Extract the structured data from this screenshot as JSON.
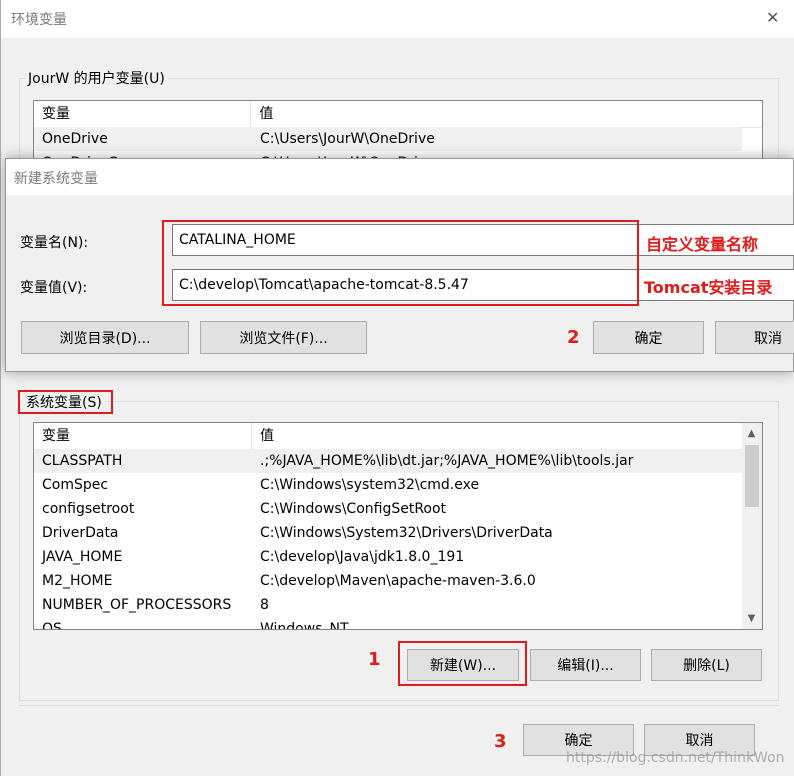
{
  "main_window": {
    "title": "环境变量",
    "close_glyph": "✕",
    "user_group_label": "JourW 的用户变量(U)",
    "user_table": {
      "headers": [
        "变量",
        "值"
      ],
      "rows": [
        [
          "OneDrive",
          "C:\\Users\\JourW\\OneDrive"
        ],
        [
          "OneDriveConsumer",
          "C:\\Users\\JourW\\OneDrive"
        ]
      ]
    },
    "system_group_label": "系统变量(S)",
    "system_table": {
      "headers": [
        "变量",
        "值"
      ],
      "rows": [
        [
          "CLASSPATH",
          ".;%JAVA_HOME%\\lib\\dt.jar;%JAVA_HOME%\\lib\\tools.jar"
        ],
        [
          "ComSpec",
          "C:\\Windows\\system32\\cmd.exe"
        ],
        [
          "configsetroot",
          "C:\\Windows\\ConfigSetRoot"
        ],
        [
          "DriverData",
          "C:\\Windows\\System32\\Drivers\\DriverData"
        ],
        [
          "JAVA_HOME",
          "C:\\develop\\Java\\jdk1.8.0_191"
        ],
        [
          "M2_HOME",
          "C:\\develop\\Maven\\apache-maven-3.6.0"
        ],
        [
          "NUMBER_OF_PROCESSORS",
          "8"
        ],
        [
          "OS",
          "Windows_NT"
        ]
      ]
    },
    "buttons": {
      "new": "新建(W)...",
      "edit": "编辑(I)...",
      "delete": "删除(L)",
      "ok": "确定",
      "cancel": "取消"
    }
  },
  "new_dialog": {
    "title": "新建系统变量",
    "name_label": "变量名(N):",
    "name_value": "CATALINA_HOME",
    "value_label": "变量值(V):",
    "value_value": "C:\\develop\\Tomcat\\apache-tomcat-8.5.47",
    "browse_dir": "浏览目录(D)...",
    "browse_file": "浏览文件(F)...",
    "ok": "确定",
    "cancel": "取消"
  },
  "annotations": {
    "name_note": "自定义变量名称",
    "value_note": "Tomcat安装目录",
    "step1": "1",
    "step2": "2",
    "step3": "3",
    "color": "#e11b1b"
  },
  "watermark": "https://blog.csdn.net/ThinkWon"
}
